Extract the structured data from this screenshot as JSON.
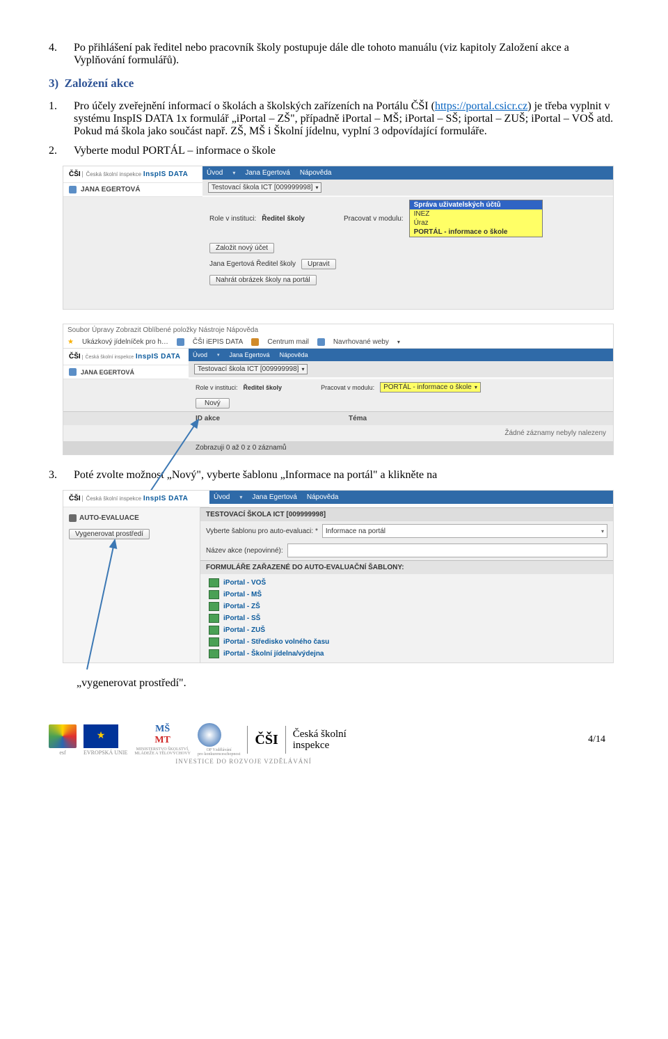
{
  "para4": {
    "num": "4.",
    "text": "Po přihlášení pak ředitel nebo pracovník školy postupuje dále dle tohoto manuálu  (viz kapitoly Založení akce a Vyplňování formulářů)."
  },
  "section3": {
    "num": "3)",
    "title": "Založení akce"
  },
  "para3_1": {
    "num": "1.",
    "pre": "Pro účely zveřejnění informací o školách a školských zařízeních na Portálu ČŠI (",
    "link_text": "https://portal.csicr.cz",
    "post": ") je třeba vyplnit v systému InspIS DATA 1x formulář „iPortal – ZŠ\", případně iPortal – MŠ; iPortal – SŠ; iportal – ZUŠ; iPortal – VOŠ atd. Pokud má škola jako součást např. ZŠ, MŠ i Školní jídelnu, vyplní 3 odpovídající formuláře."
  },
  "para3_2": {
    "num": "2.",
    "text": "Vyberte modul PORTÁL – informace o škole"
  },
  "para3_3": {
    "num": "3.",
    "text": "Poté zvolte možnost „Nový\", vyberte šablonu „Informace na portál\" a klikněte na"
  },
  "tail": "„vygenerovat prostředí\".",
  "shot1": {
    "brand_csi": "ČŠI",
    "brand_sub": "Česká školní inspekce",
    "brand_app": "InspIS DATA",
    "tabs": [
      "Úvod",
      "Jana Egertová",
      "Nápověda"
    ],
    "user": "JANA EGERTOVÁ",
    "school": "Testovací škola ICT [009999998]",
    "role_label": "Role v instituci:",
    "role_value": "Ředitel školy",
    "module_label": "Pracovat v modulu:",
    "dd_sel": "Správa uživatelských účtů",
    "dd_opts": [
      "INEZ",
      "Úraz",
      "PORTÁL - informace o škole"
    ],
    "btn_new": "Založit nový účet",
    "user2": "Jana Egertová  Ředitel školy",
    "btn_edit": "Upravit",
    "btn_upload": "Nahrát obrázek školy na portál"
  },
  "shot2": {
    "menu1": "Soubor   Úpravy   Zobrazit   Oblíbené položky   Nástroje   Nápověda",
    "menu2": [
      "Ukázkový jídelníček pro h…",
      "ČŠI iEPIS DATA",
      "Centrum mail",
      "Navrhované weby"
    ],
    "brand_app": "InspIS DATA",
    "brand_csi": "ČŠI",
    "brand_sub": "Česká školní inspekce",
    "tabs": [
      "Úvod",
      "Jana Egertová",
      "Nápověda"
    ],
    "user": "JANA EGERTOVÁ",
    "school": "Testovací škola ICT [009999998]",
    "role_label": "Role v instituci:",
    "role_value": "Ředitel školy",
    "module_label": "Pracovat v modulu:",
    "module_value": "PORTÁL - informace o škole",
    "btn_new": "Nový",
    "col1": "ID akce",
    "col2": "Téma",
    "empty": "Žádné záznamy nebyly nalezeny",
    "foot": "Zobrazuji 0 až 0 z 0 záznamů"
  },
  "shot3": {
    "brand_csi": "ČŠI",
    "brand_sub": "Česká školní inspekce",
    "brand_app": "InspIS DATA",
    "tabs": [
      "Úvod",
      "Jana Egertová",
      "Nápověda"
    ],
    "left_title": "AUTO-EVALUACE",
    "btn_gen": "Vygenerovat prostředí",
    "school": "TESTOVACÍ ŠKOLA ICT [009999998]",
    "tpl_label": "Vyberte šablonu pro auto-evaluaci: *",
    "tpl_value": "Informace na portál",
    "name_label": "Název akce (nepovinné):",
    "forms_header": "FORMULÁŘE ZAŘAZENÉ DO AUTO-EVALUAČNÍ ŠABLONY:",
    "forms": [
      "iPortal - VOŠ",
      "iPortal - MŠ",
      "iPortal - ZŠ",
      "iPortal - SŠ",
      "iPortal - ZUŠ",
      "iPortal - Středisko volného času",
      "iPortal - Školní jídelna/výdejna"
    ]
  },
  "footer": {
    "csi": "ČŠI",
    "csi_full1": "Česká školní",
    "csi_full2": "inspekce",
    "invest": "INVESTICE DO ROZVOJE VZDĚLÁVÁNÍ",
    "page": "4/14"
  }
}
